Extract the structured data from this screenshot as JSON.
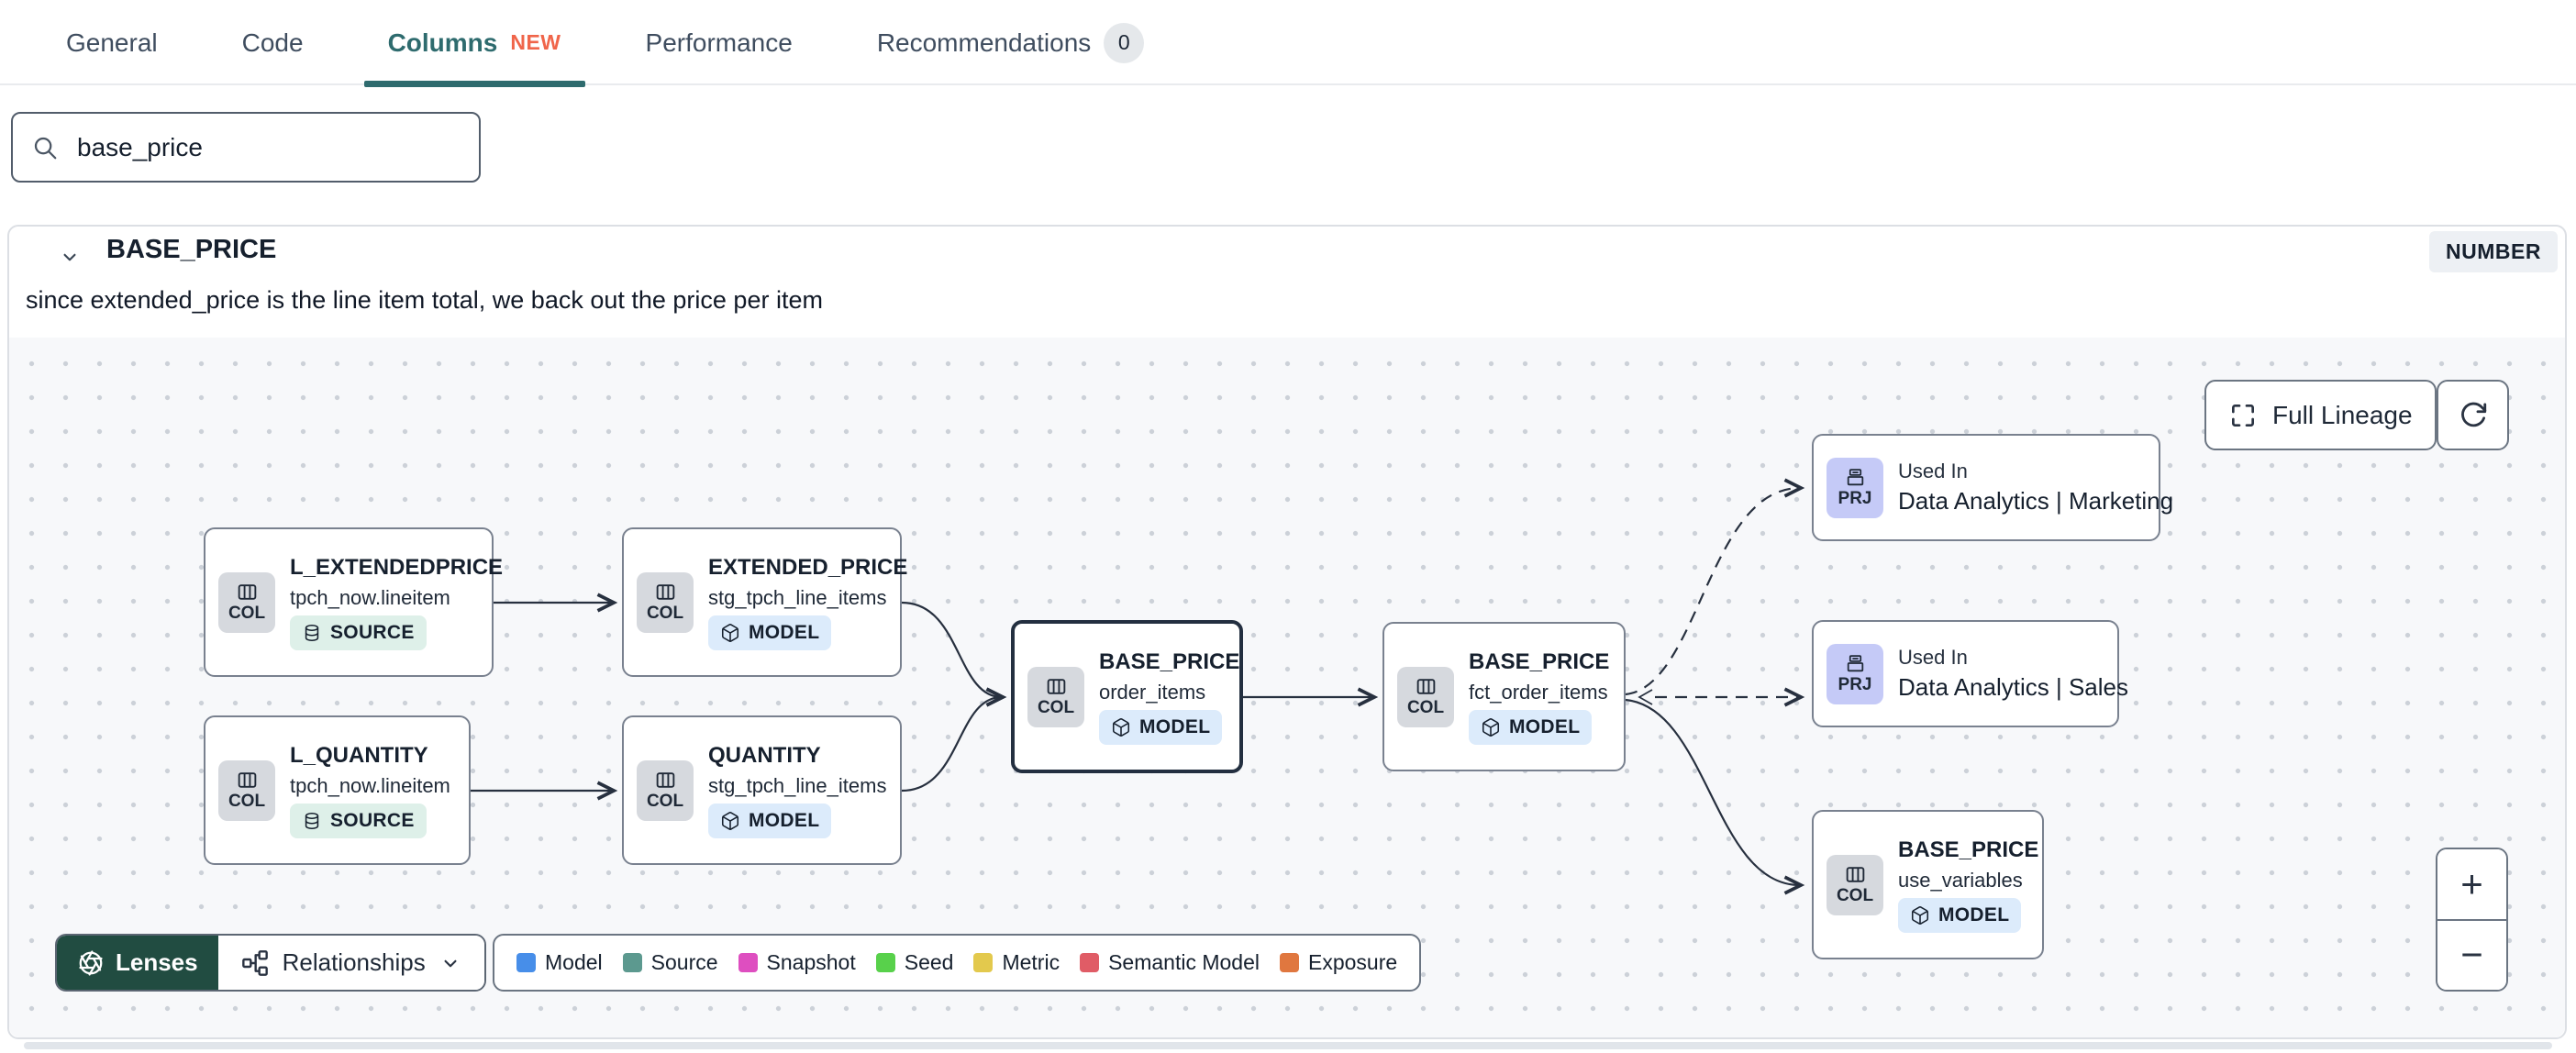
{
  "tabs": {
    "items": [
      {
        "label": "General"
      },
      {
        "label": "Code"
      },
      {
        "label": "Columns",
        "badge": "NEW",
        "active": true
      },
      {
        "label": "Performance"
      },
      {
        "label": "Recommendations",
        "count": "0"
      }
    ]
  },
  "search": {
    "value": "base_price"
  },
  "column_panel": {
    "name": "BASE_PRICE",
    "type_badge": "NUMBER",
    "description": "since extended_price is the line item total, we back out the price per item"
  },
  "lineage": {
    "controls": {
      "full_lineage_label": "Full Lineage",
      "zoom_in": "+",
      "zoom_out": "−"
    },
    "toolbar": {
      "lenses_label": "Lenses",
      "relationships_label": "Relationships"
    },
    "legend": [
      {
        "label": "Model",
        "color": "#478ee9"
      },
      {
        "label": "Source",
        "color": "#5c998f"
      },
      {
        "label": "Snapshot",
        "color": "#de4ec0"
      },
      {
        "label": "Seed",
        "color": "#58d14b"
      },
      {
        "label": "Metric",
        "color": "#e3c94d"
      },
      {
        "label": "Semantic Model",
        "color": "#e05c66"
      },
      {
        "label": "Exposure",
        "color": "#e0773f"
      }
    ],
    "nodes": [
      {
        "badge": "COL",
        "title": "L_EXTENDEDPRICE",
        "subtitle": "tpch_now.lineitem",
        "type": "SOURCE"
      },
      {
        "badge": "COL",
        "title": "EXTENDED_PRICE",
        "subtitle": "stg_tpch_line_items",
        "type": "MODEL"
      },
      {
        "badge": "COL",
        "title": "L_QUANTITY",
        "subtitle": "tpch_now.lineitem",
        "type": "SOURCE"
      },
      {
        "badge": "COL",
        "title": "QUANTITY",
        "subtitle": "stg_tpch_line_items",
        "type": "MODEL"
      },
      {
        "badge": "COL",
        "title": "BASE_PRICE",
        "subtitle": "order_items",
        "type": "MODEL",
        "selected": true
      },
      {
        "badge": "COL",
        "title": "BASE_PRICE",
        "subtitle": "fct_order_items",
        "type": "MODEL"
      },
      {
        "badge": "PRJ",
        "label": "Used In",
        "title": "Data Analytics | Marketing"
      },
      {
        "badge": "PRJ",
        "label": "Used In",
        "title": "Data Analytics | Sales"
      },
      {
        "badge": "COL",
        "title": "BASE_PRICE",
        "subtitle": "use_variables",
        "type": "MODEL"
      }
    ]
  },
  "colors": {
    "active_tab_teal": "#2e6b6e",
    "new_badge_orange": "#f0654a",
    "lenses_green": "#214c41",
    "col_badge_gray": "#d6d9de",
    "prj_badge_periwinkle": "#c5caf7",
    "source_badge_mint": "#def0e9",
    "model_badge_blue": "#dcebfb",
    "canvas_background": "#f7f8fa"
  }
}
